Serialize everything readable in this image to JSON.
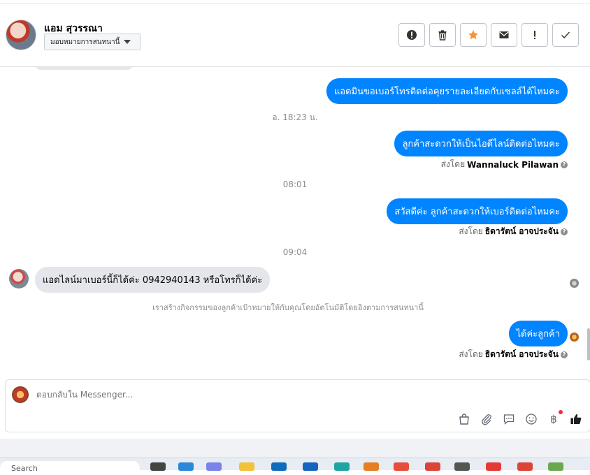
{
  "header": {
    "contact_name": "แอม สุวรรณา",
    "assign_label": "มอบหมายการสนทนานี้",
    "actions": [
      "spam-icon",
      "trash-icon",
      "star-icon",
      "mail-icon",
      "alert-icon",
      "check-icon"
    ]
  },
  "messages": [
    {
      "type": "out",
      "text": "แอดมินขอเบอร์โทรติดต่อคุยรายละเอียดกับเซลล์ได้ไหมคะ"
    },
    {
      "type": "time",
      "text": "อ. 18:23 น."
    },
    {
      "type": "out",
      "text": "ลูกค้าสะดวกให้เป็นไอดีไลน์ติดต่อไหมคะ"
    },
    {
      "type": "sentby",
      "prefix": "ส่งโดย",
      "name": "Wannaluck Pilawan"
    },
    {
      "type": "time",
      "text": "08:01"
    },
    {
      "type": "out",
      "text": "สวัสดีค่ะ ลูกค้าสะดวกให้เบอร์ติดต่อไหมคะ"
    },
    {
      "type": "sentby",
      "prefix": "ส่งโดย",
      "name": "ธิดารัตน์ อาจประจัน"
    },
    {
      "type": "time",
      "text": "09:04"
    },
    {
      "type": "in",
      "text": "แอดไลน์มาเบอร์นี้ก็ได้ค่ะ 0942940143 หรือโทรก็ได้ค่ะ"
    },
    {
      "type": "system",
      "text": "เราสร้างกิจกรรมของลูกค้าเป้าหมายให้กับคุณโดยอัตโนมัติโดยอิงตามการสนทนานี้"
    },
    {
      "type": "out",
      "text": "ได้ค่ะลูกค้า"
    },
    {
      "type": "sentby",
      "prefix": "ส่งโดย",
      "name": "ธิดารัตน์ อาจประจัน"
    }
  ],
  "composer": {
    "placeholder": "ตอบกลับใน Messenger...",
    "tools": [
      "shopping-bag-icon",
      "paperclip-icon",
      "saved-reply-icon",
      "emoji-icon",
      "baht-icon",
      "thumbs-up-icon"
    ]
  },
  "taskbar": {
    "search_label": "Search"
  },
  "colors": {
    "accent": "#0084ff",
    "incoming_bubble": "#e4e6eb",
    "notification_dot": "#f02849"
  }
}
